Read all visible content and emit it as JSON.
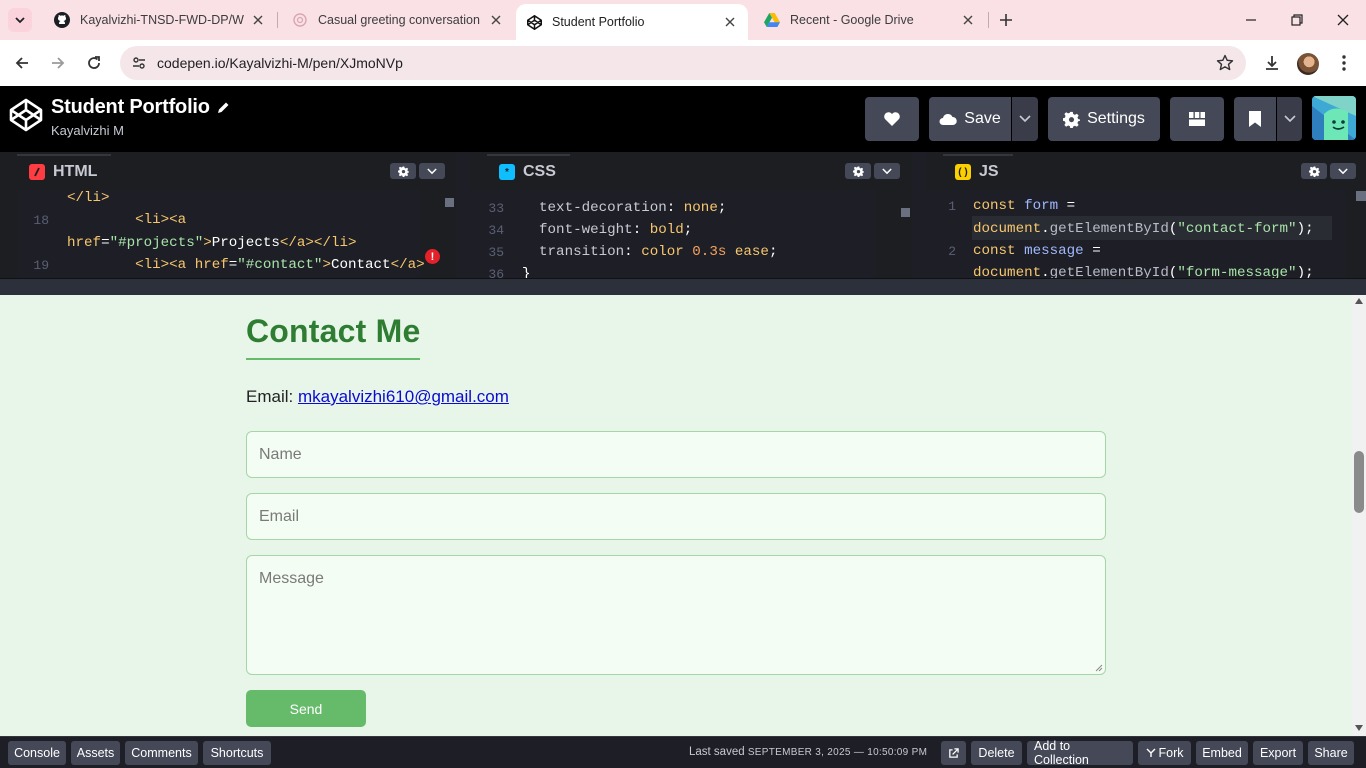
{
  "browser": {
    "tabs": [
      {
        "title": "Kayalvizhi-TNSD-FWD-DP/Wha",
        "icon": "github-icon"
      },
      {
        "title": "Casual greeting conversation",
        "icon": "chat-icon"
      },
      {
        "title": "Student Portfolio",
        "icon": "codepen-icon",
        "active": true
      },
      {
        "title": "Recent - Google Drive",
        "icon": "google-drive-icon"
      }
    ],
    "url": "codepen.io/Kayalvizhi-M/pen/XJmoNVp"
  },
  "codepen": {
    "pen_title": "Student Portfolio",
    "author": "Kayalvizhi M",
    "save_label": "Save",
    "settings_label": "Settings"
  },
  "editors": {
    "html": {
      "label": "HTML",
      "lines": [
        {
          "num": "",
          "text": "</li>"
        },
        {
          "num": "18",
          "text": "        <li><a"
        },
        {
          "num": "",
          "text": "href=\"#projects\">Projects</a></li>"
        },
        {
          "num": "19",
          "text": "        <li><a href=\"#contact\">Contact</a>"
        }
      ]
    },
    "css": {
      "label": "CSS",
      "lines": [
        {
          "num": "33",
          "text": "  text-decoration: none;"
        },
        {
          "num": "34",
          "text": "  font-weight: bold;"
        },
        {
          "num": "35",
          "text": "  transition: color 0.3s ease;"
        },
        {
          "num": "36",
          "text": "}"
        }
      ]
    },
    "js": {
      "label": "JS",
      "lines": [
        {
          "num": "1",
          "text": "const form ="
        },
        {
          "num": "",
          "text": "document.getElementById(\"contact-form\");"
        },
        {
          "num": "2",
          "text": "const message ="
        },
        {
          "num": "",
          "text": "document.getElementById(\"form-message\");"
        }
      ]
    }
  },
  "preview": {
    "heading": "Contact Me",
    "email_label": "Email:",
    "email_value": "mkayalvizhi610@gmail.com",
    "name_placeholder": "Name",
    "email_placeholder": "Email",
    "message_placeholder": "Message",
    "send_label": "Send",
    "colors": {
      "accent": "#2e7d32",
      "button": "#66bb6a",
      "background": "#e8f6ea"
    }
  },
  "footer": {
    "console": "Console",
    "assets": "Assets",
    "comments": "Comments",
    "shortcuts": "Shortcuts",
    "last_saved_label": "Last saved",
    "last_saved_value": "SEPTEMBER 3, 2025 — 10:50:09 PM",
    "delete": "Delete",
    "add_to_collection": "Add to Collection",
    "fork": "Fork",
    "embed": "Embed",
    "export": "Export",
    "share": "Share"
  }
}
